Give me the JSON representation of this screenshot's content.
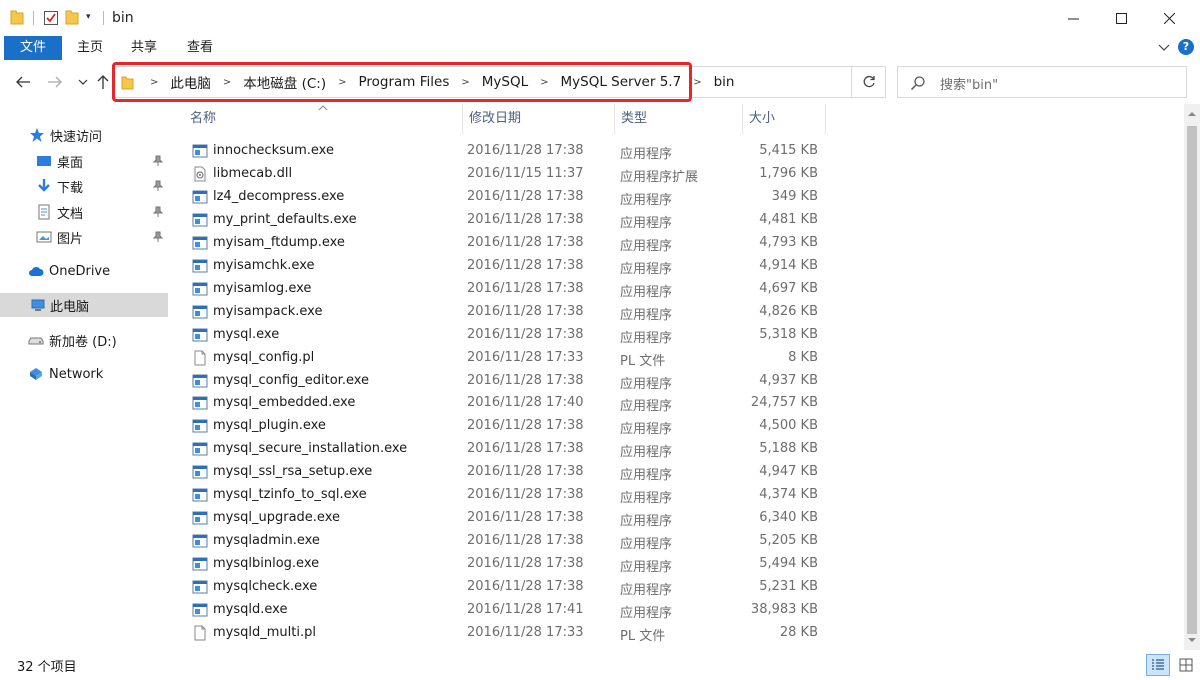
{
  "window": {
    "title": "bin",
    "minimize": "—",
    "maximize": "☐",
    "close": "✕",
    "qa_dropdown": "▾"
  },
  "ribbon": {
    "tabs": [
      "文件",
      "主页",
      "共享",
      "查看"
    ]
  },
  "address": {
    "crumbs": [
      "此电脑",
      "本地磁盘 (C:)",
      "Program Files",
      "MySQL",
      "MySQL Server 5.7",
      "bin"
    ],
    "separator": ">"
  },
  "search": {
    "placeholder": "搜索\"bin\""
  },
  "navpane": {
    "quick_access": "快速访问",
    "desktop": "桌面",
    "downloads": "下载",
    "documents": "文档",
    "pictures": "图片",
    "onedrive": "OneDrive",
    "this_pc": "此电脑",
    "volume_d": "新加卷 (D:)",
    "network": "Network"
  },
  "columns": {
    "name": "名称",
    "date": "修改日期",
    "type": "类型",
    "size": "大小"
  },
  "files": [
    {
      "name": "innochecksum.exe",
      "date": "2016/11/28 17:38",
      "type": "应用程序",
      "size": "5,415 KB",
      "icon": "exe"
    },
    {
      "name": "libmecab.dll",
      "date": "2016/11/15 11:37",
      "type": "应用程序扩展",
      "size": "1,796 KB",
      "icon": "dll"
    },
    {
      "name": "lz4_decompress.exe",
      "date": "2016/11/28 17:38",
      "type": "应用程序",
      "size": "349 KB",
      "icon": "exe"
    },
    {
      "name": "my_print_defaults.exe",
      "date": "2016/11/28 17:38",
      "type": "应用程序",
      "size": "4,481 KB",
      "icon": "exe"
    },
    {
      "name": "myisam_ftdump.exe",
      "date": "2016/11/28 17:38",
      "type": "应用程序",
      "size": "4,793 KB",
      "icon": "exe"
    },
    {
      "name": "myisamchk.exe",
      "date": "2016/11/28 17:38",
      "type": "应用程序",
      "size": "4,914 KB",
      "icon": "exe"
    },
    {
      "name": "myisamlog.exe",
      "date": "2016/11/28 17:38",
      "type": "应用程序",
      "size": "4,697 KB",
      "icon": "exe"
    },
    {
      "name": "myisampack.exe",
      "date": "2016/11/28 17:38",
      "type": "应用程序",
      "size": "4,826 KB",
      "icon": "exe"
    },
    {
      "name": "mysql.exe",
      "date": "2016/11/28 17:38",
      "type": "应用程序",
      "size": "5,318 KB",
      "icon": "exe"
    },
    {
      "name": "mysql_config.pl",
      "date": "2016/11/28 17:33",
      "type": "PL 文件",
      "size": "8 KB",
      "icon": "file"
    },
    {
      "name": "mysql_config_editor.exe",
      "date": "2016/11/28 17:38",
      "type": "应用程序",
      "size": "4,937 KB",
      "icon": "exe"
    },
    {
      "name": "mysql_embedded.exe",
      "date": "2016/11/28 17:40",
      "type": "应用程序",
      "size": "24,757 KB",
      "icon": "exe"
    },
    {
      "name": "mysql_plugin.exe",
      "date": "2016/11/28 17:38",
      "type": "应用程序",
      "size": "4,500 KB",
      "icon": "exe"
    },
    {
      "name": "mysql_secure_installation.exe",
      "date": "2016/11/28 17:38",
      "type": "应用程序",
      "size": "5,188 KB",
      "icon": "exe"
    },
    {
      "name": "mysql_ssl_rsa_setup.exe",
      "date": "2016/11/28 17:38",
      "type": "应用程序",
      "size": "4,947 KB",
      "icon": "exe"
    },
    {
      "name": "mysql_tzinfo_to_sql.exe",
      "date": "2016/11/28 17:38",
      "type": "应用程序",
      "size": "4,374 KB",
      "icon": "exe"
    },
    {
      "name": "mysql_upgrade.exe",
      "date": "2016/11/28 17:38",
      "type": "应用程序",
      "size": "6,340 KB",
      "icon": "exe"
    },
    {
      "name": "mysqladmin.exe",
      "date": "2016/11/28 17:38",
      "type": "应用程序",
      "size": "5,205 KB",
      "icon": "exe"
    },
    {
      "name": "mysqlbinlog.exe",
      "date": "2016/11/28 17:38",
      "type": "应用程序",
      "size": "5,494 KB",
      "icon": "exe"
    },
    {
      "name": "mysqlcheck.exe",
      "date": "2016/11/28 17:38",
      "type": "应用程序",
      "size": "5,231 KB",
      "icon": "exe"
    },
    {
      "name": "mysqld.exe",
      "date": "2016/11/28 17:41",
      "type": "应用程序",
      "size": "38,983 KB",
      "icon": "exe"
    },
    {
      "name": "mysqld_multi.pl",
      "date": "2016/11/28 17:33",
      "type": "PL 文件",
      "size": "28 KB",
      "icon": "file"
    }
  ],
  "status": {
    "item_count": "32 个项目"
  },
  "colors": {
    "accent": "#1a6fc7",
    "highlight_border": "#e8262a",
    "header_text": "#4d6082",
    "folder_yellow": "#f5c84c"
  }
}
